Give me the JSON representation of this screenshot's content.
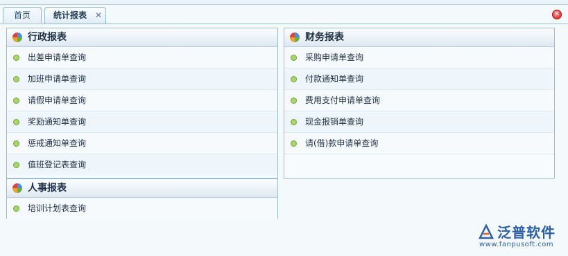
{
  "tabs": [
    {
      "label": "首页",
      "active": false
    },
    {
      "label": "统计报表",
      "active": true
    }
  ],
  "panels": {
    "admin": {
      "title": "行政报表",
      "items": [
        "出差申请单查询",
        "加班申请单查询",
        "请假申请单查询",
        "奖励通知单查询",
        "惩戒通知单查询",
        "值班登记表查询"
      ]
    },
    "finance": {
      "title": "财务报表",
      "items": [
        "采购申请单查询",
        "付款通知单查询",
        "费用支付申请单查询",
        "现金报销单查询",
        "请(借)款申请单查询"
      ]
    },
    "hr": {
      "title": "人事报表",
      "items": [
        "培训计划表查询"
      ]
    }
  },
  "logo": {
    "text": "泛普软件",
    "url": "www.fanpusoft.com"
  },
  "icons": {
    "tab_close": "close-icon",
    "close_all": "close-all-icon",
    "panel": "report-pie-icon",
    "bullet": "green-dot-icon"
  },
  "colors": {
    "border": "#9cbcd4",
    "accent": "#2c5fa8",
    "bullet": "#a8d66b",
    "close": "#d21a1a"
  }
}
